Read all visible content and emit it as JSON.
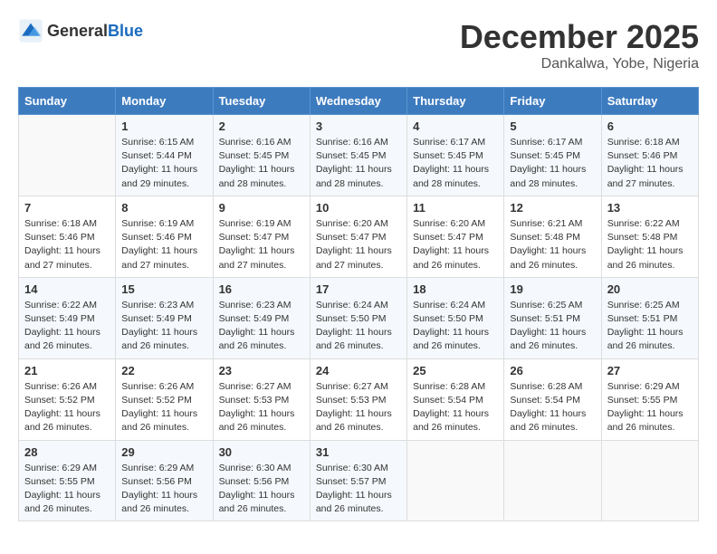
{
  "header": {
    "logo_general": "General",
    "logo_blue": "Blue",
    "month_year": "December 2025",
    "location": "Dankalwa, Yobe, Nigeria"
  },
  "days_of_week": [
    "Sunday",
    "Monday",
    "Tuesday",
    "Wednesday",
    "Thursday",
    "Friday",
    "Saturday"
  ],
  "weeks": [
    [
      {
        "day": "",
        "info": ""
      },
      {
        "day": "1",
        "info": "Sunrise: 6:15 AM\nSunset: 5:44 PM\nDaylight: 11 hours and 29 minutes."
      },
      {
        "day": "2",
        "info": "Sunrise: 6:16 AM\nSunset: 5:45 PM\nDaylight: 11 hours and 28 minutes."
      },
      {
        "day": "3",
        "info": "Sunrise: 6:16 AM\nSunset: 5:45 PM\nDaylight: 11 hours and 28 minutes."
      },
      {
        "day": "4",
        "info": "Sunrise: 6:17 AM\nSunset: 5:45 PM\nDaylight: 11 hours and 28 minutes."
      },
      {
        "day": "5",
        "info": "Sunrise: 6:17 AM\nSunset: 5:45 PM\nDaylight: 11 hours and 28 minutes."
      },
      {
        "day": "6",
        "info": "Sunrise: 6:18 AM\nSunset: 5:46 PM\nDaylight: 11 hours and 27 minutes."
      }
    ],
    [
      {
        "day": "7",
        "info": "Sunrise: 6:18 AM\nSunset: 5:46 PM\nDaylight: 11 hours and 27 minutes."
      },
      {
        "day": "8",
        "info": "Sunrise: 6:19 AM\nSunset: 5:46 PM\nDaylight: 11 hours and 27 minutes."
      },
      {
        "day": "9",
        "info": "Sunrise: 6:19 AM\nSunset: 5:47 PM\nDaylight: 11 hours and 27 minutes."
      },
      {
        "day": "10",
        "info": "Sunrise: 6:20 AM\nSunset: 5:47 PM\nDaylight: 11 hours and 27 minutes."
      },
      {
        "day": "11",
        "info": "Sunrise: 6:20 AM\nSunset: 5:47 PM\nDaylight: 11 hours and 26 minutes."
      },
      {
        "day": "12",
        "info": "Sunrise: 6:21 AM\nSunset: 5:48 PM\nDaylight: 11 hours and 26 minutes."
      },
      {
        "day": "13",
        "info": "Sunrise: 6:22 AM\nSunset: 5:48 PM\nDaylight: 11 hours and 26 minutes."
      }
    ],
    [
      {
        "day": "14",
        "info": "Sunrise: 6:22 AM\nSunset: 5:49 PM\nDaylight: 11 hours and 26 minutes."
      },
      {
        "day": "15",
        "info": "Sunrise: 6:23 AM\nSunset: 5:49 PM\nDaylight: 11 hours and 26 minutes."
      },
      {
        "day": "16",
        "info": "Sunrise: 6:23 AM\nSunset: 5:49 PM\nDaylight: 11 hours and 26 minutes."
      },
      {
        "day": "17",
        "info": "Sunrise: 6:24 AM\nSunset: 5:50 PM\nDaylight: 11 hours and 26 minutes."
      },
      {
        "day": "18",
        "info": "Sunrise: 6:24 AM\nSunset: 5:50 PM\nDaylight: 11 hours and 26 minutes."
      },
      {
        "day": "19",
        "info": "Sunrise: 6:25 AM\nSunset: 5:51 PM\nDaylight: 11 hours and 26 minutes."
      },
      {
        "day": "20",
        "info": "Sunrise: 6:25 AM\nSunset: 5:51 PM\nDaylight: 11 hours and 26 minutes."
      }
    ],
    [
      {
        "day": "21",
        "info": "Sunrise: 6:26 AM\nSunset: 5:52 PM\nDaylight: 11 hours and 26 minutes."
      },
      {
        "day": "22",
        "info": "Sunrise: 6:26 AM\nSunset: 5:52 PM\nDaylight: 11 hours and 26 minutes."
      },
      {
        "day": "23",
        "info": "Sunrise: 6:27 AM\nSunset: 5:53 PM\nDaylight: 11 hours and 26 minutes."
      },
      {
        "day": "24",
        "info": "Sunrise: 6:27 AM\nSunset: 5:53 PM\nDaylight: 11 hours and 26 minutes."
      },
      {
        "day": "25",
        "info": "Sunrise: 6:28 AM\nSunset: 5:54 PM\nDaylight: 11 hours and 26 minutes."
      },
      {
        "day": "26",
        "info": "Sunrise: 6:28 AM\nSunset: 5:54 PM\nDaylight: 11 hours and 26 minutes."
      },
      {
        "day": "27",
        "info": "Sunrise: 6:29 AM\nSunset: 5:55 PM\nDaylight: 11 hours and 26 minutes."
      }
    ],
    [
      {
        "day": "28",
        "info": "Sunrise: 6:29 AM\nSunset: 5:55 PM\nDaylight: 11 hours and 26 minutes."
      },
      {
        "day": "29",
        "info": "Sunrise: 6:29 AM\nSunset: 5:56 PM\nDaylight: 11 hours and 26 minutes."
      },
      {
        "day": "30",
        "info": "Sunrise: 6:30 AM\nSunset: 5:56 PM\nDaylight: 11 hours and 26 minutes."
      },
      {
        "day": "31",
        "info": "Sunrise: 6:30 AM\nSunset: 5:57 PM\nDaylight: 11 hours and 26 minutes."
      },
      {
        "day": "",
        "info": ""
      },
      {
        "day": "",
        "info": ""
      },
      {
        "day": "",
        "info": ""
      }
    ]
  ]
}
